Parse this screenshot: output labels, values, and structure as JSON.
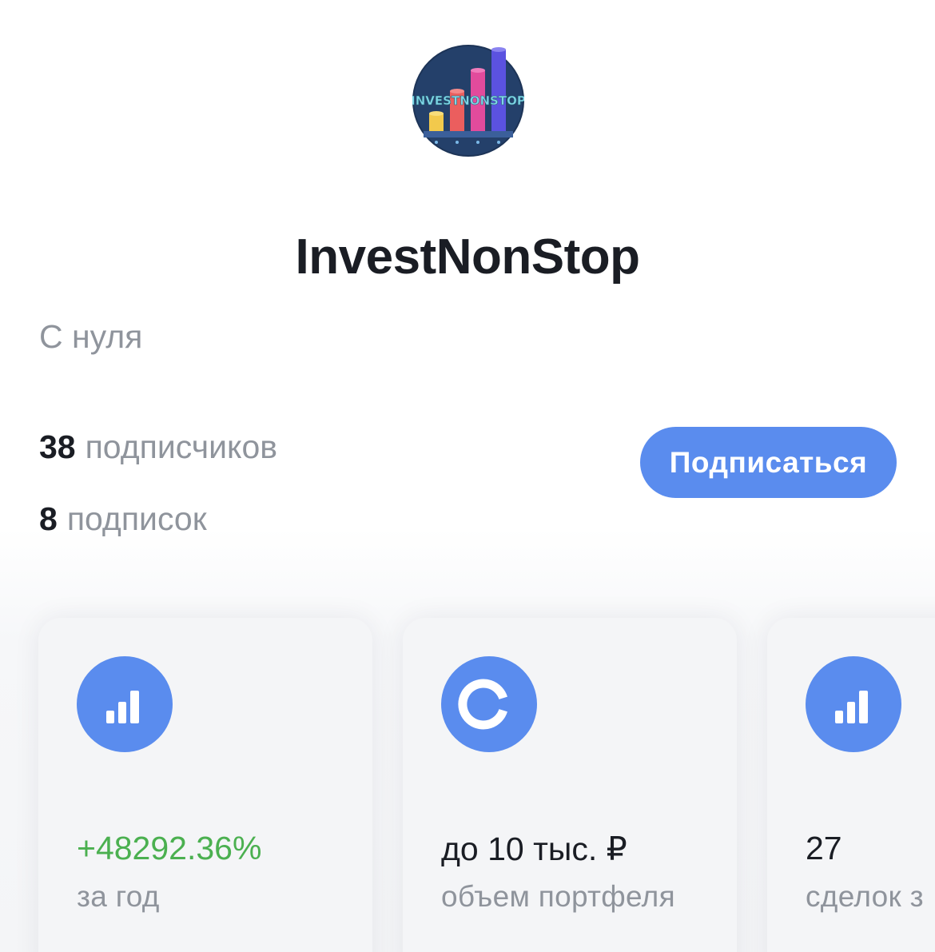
{
  "profile": {
    "avatar_text": "INVESTNONSTOP",
    "avatar_icon": "logo-bar-chart",
    "name": "InvestNonStop",
    "subtitle": "С нуля"
  },
  "stats": {
    "followers_count": "38",
    "followers_label": "подписчиков",
    "following_count": "8",
    "following_label": "подписок"
  },
  "actions": {
    "subscribe_label": "Подписаться"
  },
  "cards": [
    {
      "icon": "bar-chart-icon",
      "value": "+48292.36%",
      "label": "за год"
    },
    {
      "icon": "ring-chart-icon",
      "value": "до 10 тыс. ₽",
      "label": "объем портфеля"
    },
    {
      "icon": "bar-chart-icon",
      "value": "27",
      "label": "сделок з"
    }
  ],
  "colors": {
    "accent": "#5a8cee",
    "positive": "#4bb050",
    "text": "#1a1d24",
    "muted": "#8f949c"
  }
}
